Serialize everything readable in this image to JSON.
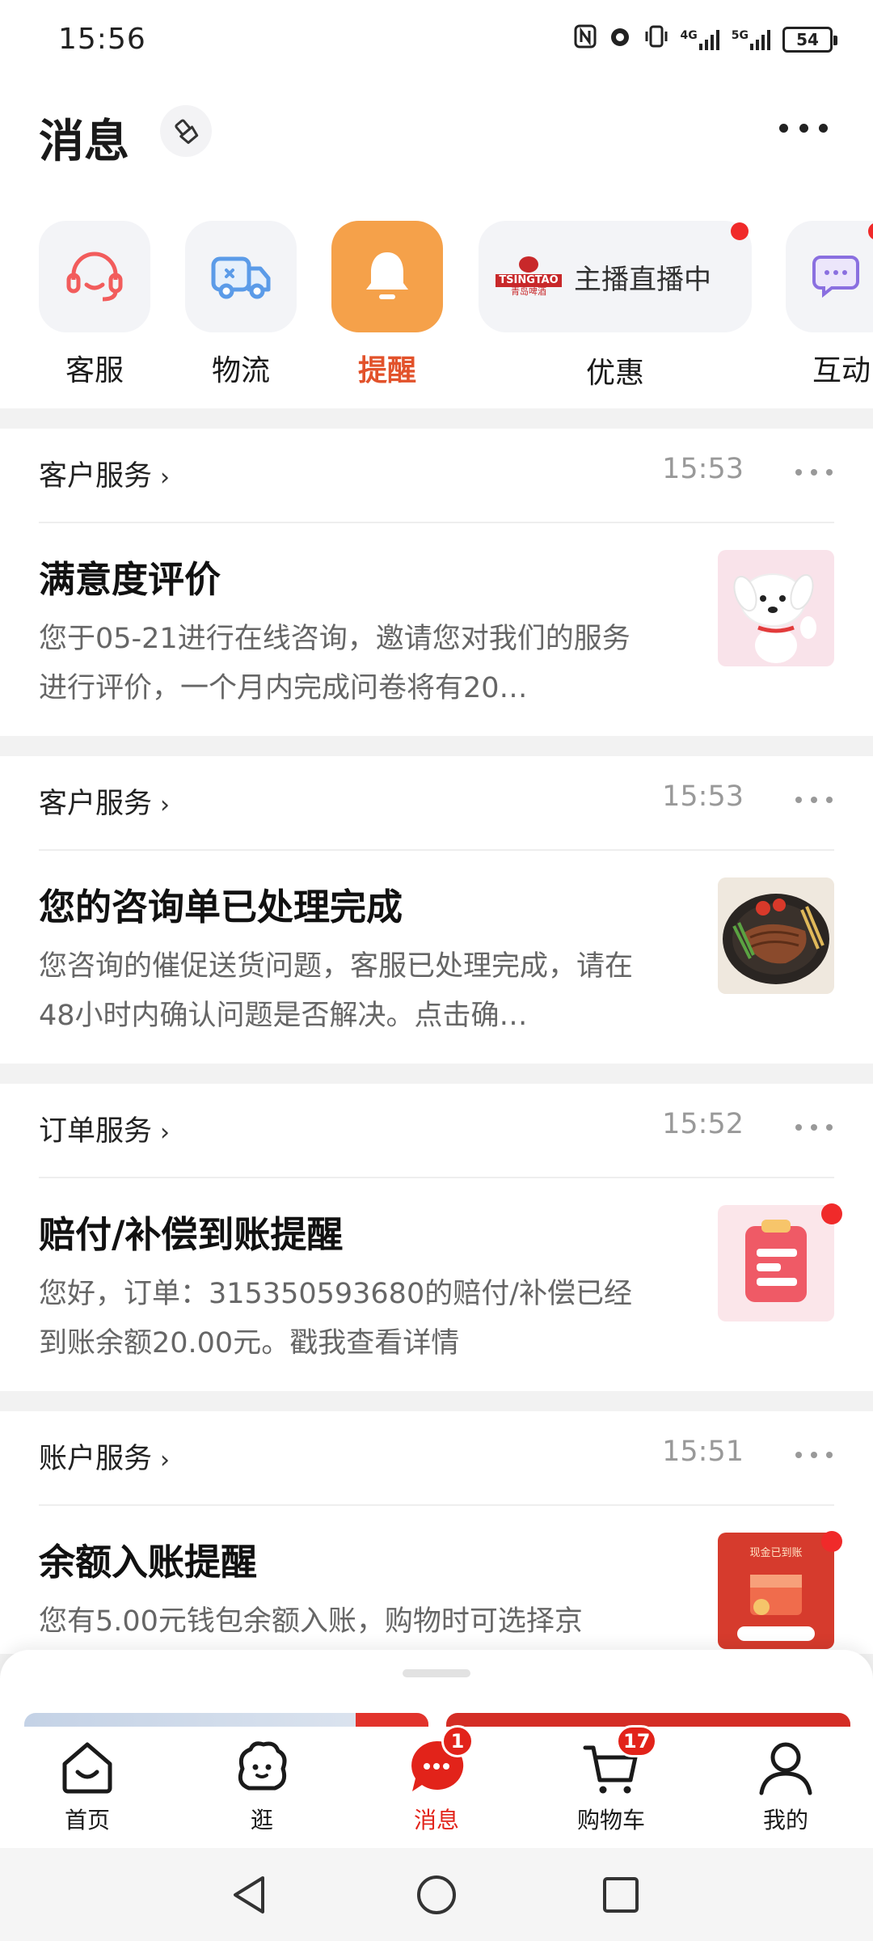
{
  "status_bar": {
    "time": "15:56",
    "signal_4g": "4G",
    "signal_5g": "5G",
    "battery": "54"
  },
  "header": {
    "title": "消息"
  },
  "categories": [
    {
      "label": "客服",
      "icon": "headset-icon"
    },
    {
      "label": "物流",
      "icon": "truck-icon"
    },
    {
      "label": "提醒",
      "icon": "bell-icon",
      "active": true
    },
    {
      "label": "优惠",
      "promo_text": "主播直播中",
      "logo_text": "TSINGTAO",
      "logo_sub": "青岛啤酒"
    },
    {
      "label": "互动",
      "icon": "chat-bubbles-icon"
    }
  ],
  "messages": [
    {
      "source": "客户服务",
      "time": "15:53",
      "title": "满意度评价",
      "body": "您于05-21进行在线咨询，邀请您对我们的服务进行评价，一个月内完成问卷将有20…",
      "thumb": "mascot-thumbnail"
    },
    {
      "source": "客户服务",
      "time": "15:53",
      "title": "您的咨询单已处理完成",
      "body": "您咨询的催促送货问题，客服已处理完成，请在48小时内确认问题是否解决。点击确…",
      "thumb": "steak-thumbnail"
    },
    {
      "source": "订单服务",
      "time": "15:52",
      "title": "赔付/补偿到账提醒",
      "body": "您好，订单：315350593680的赔付/补偿已经到账余额20.00元。戳我查看详情",
      "thumb": "clipboard-thumbnail"
    },
    {
      "source": "账户服务",
      "time": "15:51",
      "title": "余额入账提醒",
      "body": "您有5.00元钱包余额入账，购物时可选择京",
      "thumb": "cash-thumbnail",
      "thumb_text": "现金已到账"
    }
  ],
  "tabs": [
    {
      "label": "首页",
      "icon": "home-icon"
    },
    {
      "label": "逛",
      "icon": "explore-icon"
    },
    {
      "label": "消息",
      "icon": "message-icon",
      "badge": "1",
      "active": true
    },
    {
      "label": "购物车",
      "icon": "cart-icon",
      "badge": "17"
    },
    {
      "label": "我的",
      "icon": "profile-icon"
    }
  ],
  "colors": {
    "accent": "#e2231a",
    "active_tile": "#f5a14a",
    "active_label": "#e2522b"
  }
}
